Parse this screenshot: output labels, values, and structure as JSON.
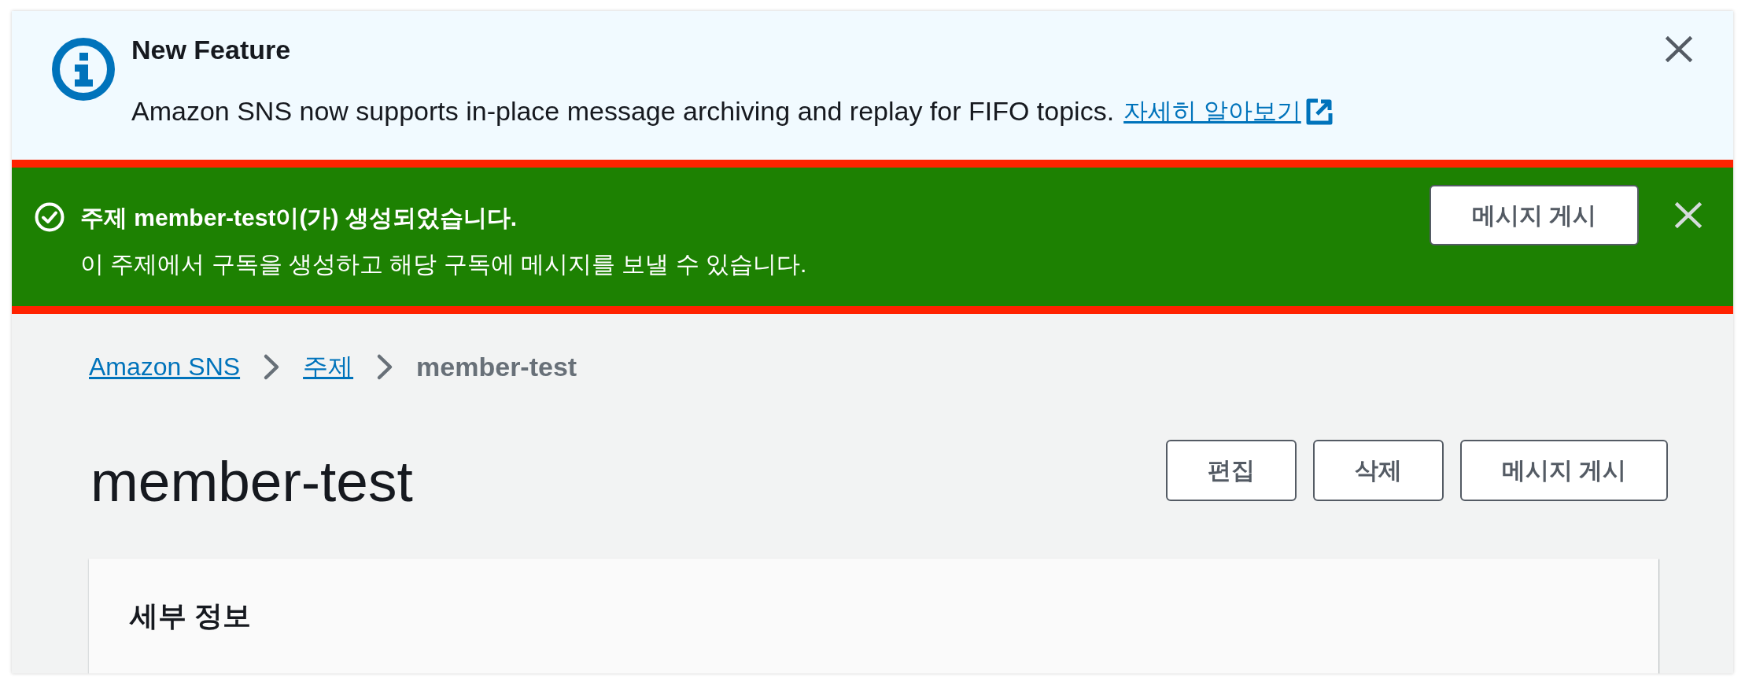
{
  "flashes": [
    {
      "kind": "info",
      "highlighted": false,
      "title": "New Feature",
      "message": "Amazon SNS now supports in-place message archiving and replay for FIFO topics.",
      "link": "자세히 알아보기"
    },
    {
      "kind": "success",
      "highlighted": true,
      "title": "주제 member-test이(가) 생성되었습니다.",
      "message": "이 주제에서 구독을 생성하고 해당 구독에 메시지를 보낼 수 있습니다.",
      "button": "메시지 게시"
    }
  ],
  "breadcrumbs": [
    {
      "kind": "link",
      "label": "Amazon SNS"
    },
    {
      "kind": "link",
      "label": "주제"
    },
    {
      "kind": "current",
      "label": "member-test"
    }
  ],
  "page": {
    "title": "member-test",
    "buttons": [
      "편집",
      "삭제",
      "메시지 게시"
    ]
  },
  "details_panel": {
    "title": "세부 정보"
  }
}
